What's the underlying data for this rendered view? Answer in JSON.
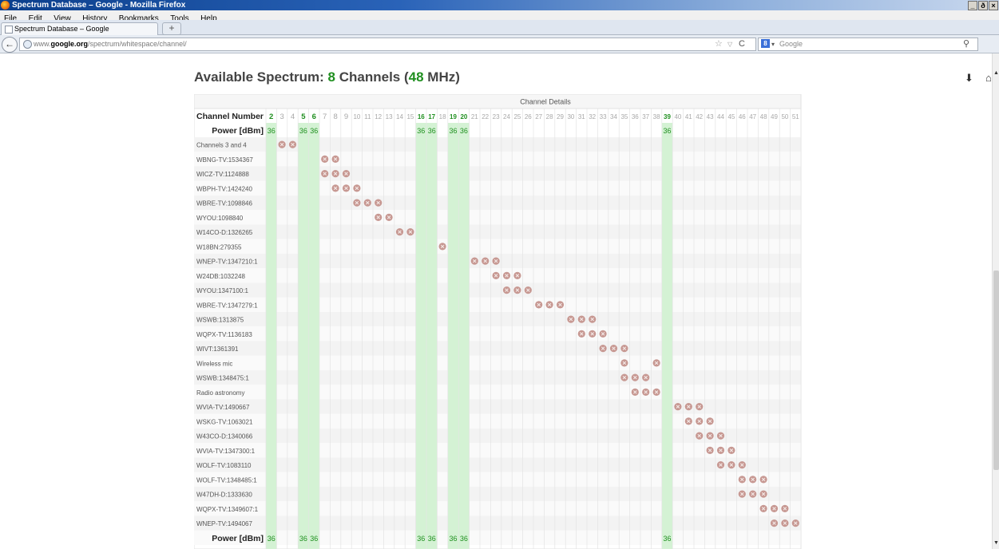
{
  "window": {
    "title": "Spectrum Database – Google - Mozilla Firefox",
    "controls": [
      "_",
      "ð",
      "×"
    ]
  },
  "menu": [
    "File",
    "Edit",
    "View",
    "History",
    "Bookmarks",
    "Tools",
    "Help"
  ],
  "tab": {
    "label": "Spectrum Database – Google",
    "new_tab": "+"
  },
  "nav": {
    "back": "←",
    "url_plain_before": "www.",
    "url_bold": "google.org",
    "url_plain_after": "/spectrum/whitespace/channel/",
    "search_placeholder": "Google",
    "search_engine_letter": "8"
  },
  "page": {
    "heading_prefix": "Available Spectrum: ",
    "heading_count": "8",
    "heading_mid": " Channels (",
    "heading_mhz": "48",
    "heading_suffix": " MHz)"
  },
  "table": {
    "caption": "Channel Details",
    "channel_header": "Channel Number",
    "power_header": "Power [dBm]",
    "channels": [
      2,
      3,
      4,
      5,
      6,
      7,
      8,
      9,
      10,
      11,
      12,
      13,
      14,
      15,
      16,
      17,
      18,
      19,
      20,
      21,
      22,
      23,
      24,
      25,
      26,
      27,
      28,
      29,
      30,
      31,
      32,
      33,
      34,
      35,
      36,
      37,
      38,
      39,
      40,
      41,
      42,
      43,
      44,
      45,
      46,
      47,
      48,
      49,
      50,
      51
    ],
    "available": [
      2,
      5,
      6,
      16,
      17,
      19,
      20,
      39
    ],
    "power": {
      "2": "36",
      "5": "36",
      "6": "36",
      "16": "36",
      "17": "36",
      "19": "36",
      "20": "36",
      "39": "36"
    },
    "rows": [
      {
        "name": "Channels 3 and 4",
        "blocked": [
          3,
          4
        ]
      },
      {
        "name": "WBNG-TV:1534367",
        "blocked": [
          7,
          8
        ]
      },
      {
        "name": "WICZ-TV:1124888",
        "blocked": [
          7,
          8,
          9
        ]
      },
      {
        "name": "WBPH-TV:1424240",
        "blocked": [
          8,
          9,
          10
        ]
      },
      {
        "name": "WBRE-TV:1098846",
        "blocked": [
          10,
          11,
          12
        ]
      },
      {
        "name": "WYOU:1098840",
        "blocked": [
          12,
          13
        ]
      },
      {
        "name": "W14CO-D:1326265",
        "blocked": [
          14,
          15
        ]
      },
      {
        "name": "W18BN:279355",
        "blocked": [
          18
        ]
      },
      {
        "name": "WNEP-TV:1347210:1",
        "blocked": [
          21,
          22,
          23
        ]
      },
      {
        "name": "W24DB:1032248",
        "blocked": [
          23,
          24,
          25
        ]
      },
      {
        "name": "WYOU:1347100:1",
        "blocked": [
          24,
          25,
          26
        ]
      },
      {
        "name": "WBRE-TV:1347279:1",
        "blocked": [
          27,
          28,
          29
        ]
      },
      {
        "name": "WSWB:1313875",
        "blocked": [
          30,
          31,
          32
        ]
      },
      {
        "name": "WQPX-TV:1136183",
        "blocked": [
          31,
          32,
          33
        ]
      },
      {
        "name": "WIVT:1361391",
        "blocked": [
          33,
          34,
          35
        ]
      },
      {
        "name": "Wireless mic",
        "blocked": [
          35,
          38
        ]
      },
      {
        "name": "WSWB:1348475:1",
        "blocked": [
          35,
          36,
          37
        ]
      },
      {
        "name": "Radio astronomy",
        "blocked": [
          36,
          37,
          38
        ]
      },
      {
        "name": "WVIA-TV:1490667",
        "blocked": [
          40,
          41,
          42
        ]
      },
      {
        "name": "WSKG-TV:1063021",
        "blocked": [
          41,
          42,
          43
        ]
      },
      {
        "name": "W43CO-D:1340066",
        "blocked": [
          42,
          43,
          44
        ]
      },
      {
        "name": "WVIA-TV:1347300:1",
        "blocked": [
          43,
          44,
          45
        ]
      },
      {
        "name": "WOLF-TV:1083110",
        "blocked": [
          44,
          45,
          46
        ]
      },
      {
        "name": "WOLF-TV:1348485:1",
        "blocked": [
          46,
          47,
          48
        ]
      },
      {
        "name": "W47DH-D:1333630",
        "blocked": [
          46,
          47,
          48
        ]
      },
      {
        "name": "WQPX-TV:1349607:1",
        "blocked": [
          48,
          49,
          50
        ]
      },
      {
        "name": "WNEP-TV:1494067",
        "blocked": [
          49,
          50,
          51
        ]
      }
    ]
  },
  "colors": {
    "available_green": "#1f8f1f",
    "available_column": "#d4f2d4",
    "blocked_icon": "#c79892",
    "channel_muted": "#a8a8a8"
  }
}
